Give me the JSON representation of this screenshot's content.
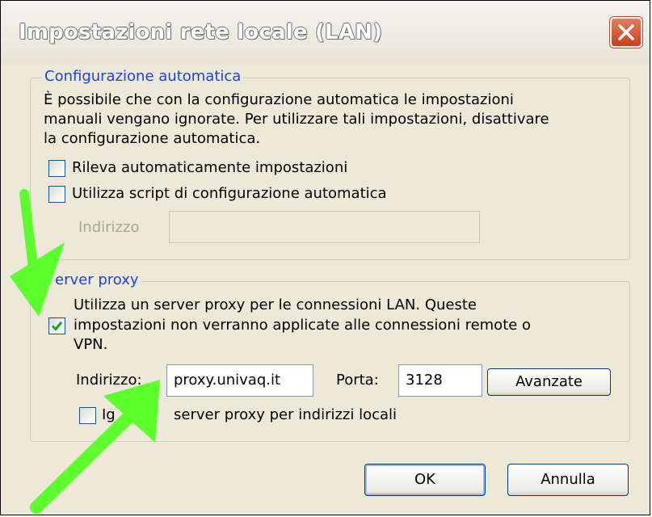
{
  "window": {
    "title": "Impostazioni rete locale (LAN)"
  },
  "auto_config": {
    "legend": "Configurazione automatica",
    "description_lines": [
      "È possibile che con la configurazione automatica le impostazioni",
      "manuali vengano ignorate. Per utilizzare tali impostazioni, disattivare",
      "la configurazione automatica."
    ],
    "detect_settings": {
      "label": "Rileva automaticamente impostazioni",
      "checked": false
    },
    "use_script": {
      "label": "Utilizza script di configurazione automatica",
      "checked": false
    },
    "address_label": "Indirizzo",
    "address_value": ""
  },
  "proxy": {
    "legend": "erver proxy",
    "use_proxy": {
      "label_lines": [
        "Utilizza un server proxy per le connessioni LAN. Queste",
        "impostazioni non verranno applicate alle connessioni remote o",
        "VPN."
      ],
      "checked": true
    },
    "address_label": "Indirizzo:",
    "address_value": "proxy.univaq.it",
    "port_label": "Porta:",
    "port_value": "3128",
    "advanced_button": "Avanzate",
    "bypass": {
      "label_start": "Ig",
      "label_end": "server proxy per indirizzi locali",
      "checked": false
    }
  },
  "buttons": {
    "ok": "OK",
    "cancel": "Annulla"
  },
  "colors": {
    "legend": "#1f42d9",
    "annotation_arrow": "#5cff2b",
    "face": "#ece9d8",
    "check": "#21a121"
  }
}
